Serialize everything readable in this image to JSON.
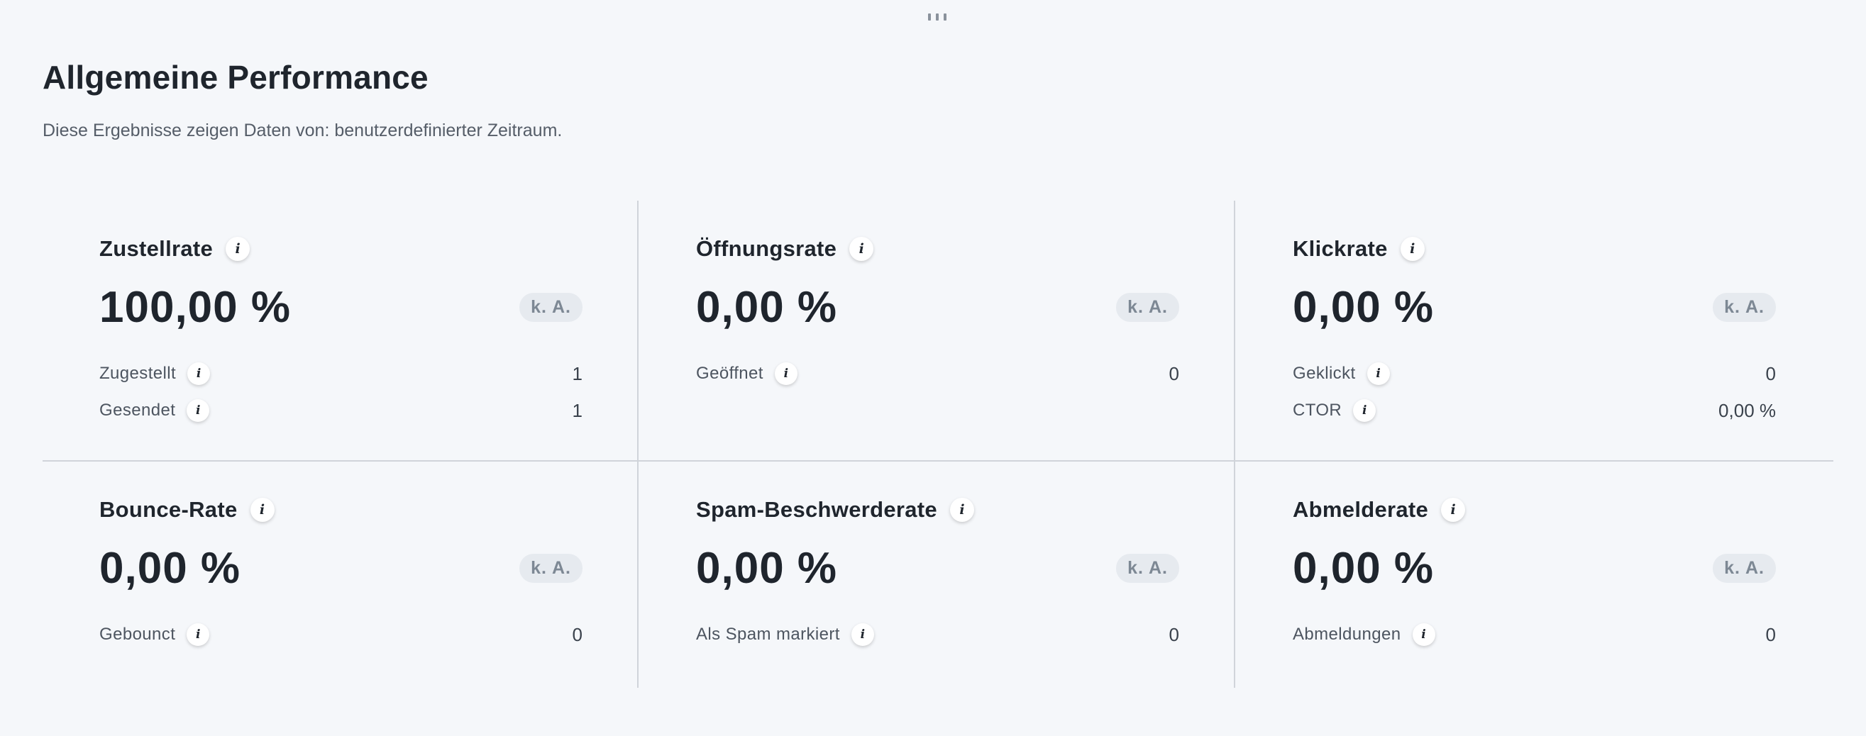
{
  "header": {
    "title": "Allgemeine Performance",
    "subtitle": "Diese Ergebnisse zeigen Daten von: benutzerdefinierter Zeitraum."
  },
  "icons": {
    "info": "i"
  },
  "badge_label": "k. A.",
  "metrics": [
    {
      "title": "Zustellrate",
      "value": "100,00 %",
      "rows": [
        {
          "label": "Zugestellt",
          "value": "1"
        },
        {
          "label": "Gesendet",
          "value": "1"
        }
      ]
    },
    {
      "title": "Öffnungsrate",
      "value": "0,00 %",
      "rows": [
        {
          "label": "Geöffnet",
          "value": "0"
        }
      ]
    },
    {
      "title": "Klickrate",
      "value": "0,00 %",
      "rows": [
        {
          "label": "Geklickt",
          "value": "0"
        },
        {
          "label": "CTOR",
          "value": "0,00 %"
        }
      ]
    },
    {
      "title": "Bounce-Rate",
      "value": "0,00 %",
      "rows": [
        {
          "label": "Gebounct",
          "value": "0"
        }
      ]
    },
    {
      "title": "Spam-Beschwerderate",
      "value": "0,00 %",
      "rows": [
        {
          "label": "Als Spam markiert",
          "value": "0"
        }
      ]
    },
    {
      "title": "Abmelderate",
      "value": "0,00 %",
      "rows": [
        {
          "label": "Abmeldungen",
          "value": "0"
        }
      ]
    }
  ]
}
